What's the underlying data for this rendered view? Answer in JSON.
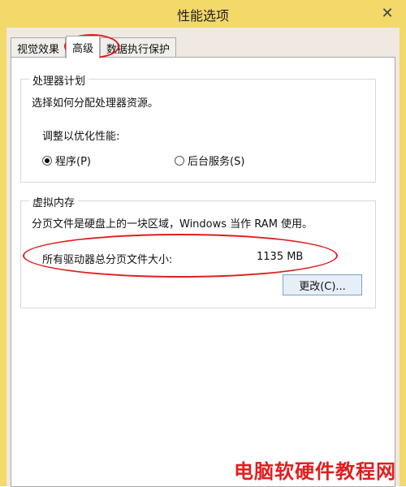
{
  "window": {
    "title": "性能选项",
    "close_glyph": "✕"
  },
  "tabs": [
    {
      "label": "视觉效果",
      "active": false
    },
    {
      "label": "高级",
      "active": true
    },
    {
      "label": "数据执行保护",
      "active": false
    }
  ],
  "processor_scheduling": {
    "group_title": "处理器计划",
    "description": "选择如何分配处理器资源。",
    "adjust_label": "调整以优化性能:",
    "options": [
      {
        "label": "程序(P)",
        "checked": true
      },
      {
        "label": "后台服务(S)",
        "checked": false
      }
    ]
  },
  "virtual_memory": {
    "group_title": "虚拟内存",
    "description": "分页文件是硬盘上的一块区域，Windows 当作 RAM 使用。",
    "total_label": "所有驱动器总分页文件大小:",
    "total_value": "1135 MB",
    "change_button": "更改(C)..."
  },
  "watermark": "电脑软硬件教程网",
  "annotation_color": "#e11d1d",
  "titlebar_color": "#f3d86a"
}
